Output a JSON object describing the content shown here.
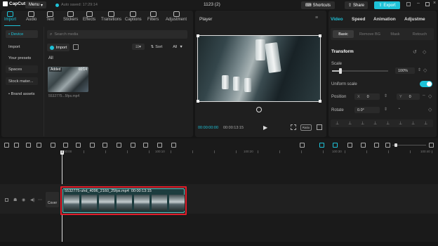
{
  "titlebar": {
    "app_name": "CapCut",
    "menu_label": "Menu",
    "autosave": "Auto saved: 17:29:14",
    "project_name": "1123 (2)",
    "shortcuts_label": "Shortcuts",
    "share_label": "Share",
    "export_label": "Export"
  },
  "toolbar": {
    "items": [
      {
        "label": "Import",
        "icon": "import-icon"
      },
      {
        "label": "Audio",
        "icon": "audio-icon"
      },
      {
        "label": "Text",
        "icon": "text-icon"
      },
      {
        "label": "Stickers",
        "icon": "stickers-icon"
      },
      {
        "label": "Effects",
        "icon": "effects-icon"
      },
      {
        "label": "Transitions",
        "icon": "transitions-icon"
      },
      {
        "label": "Captions",
        "icon": "captions-icon"
      },
      {
        "label": "Filters",
        "icon": "filters-icon"
      },
      {
        "label": "Adjustment",
        "icon": "adjustment-icon"
      }
    ]
  },
  "media_sidebar": {
    "items": [
      "• Device",
      "Import",
      "Your presets",
      "Spaces",
      "Stock mater...",
      "• Brand assets"
    ]
  },
  "media": {
    "search_placeholder": "Search media",
    "import_label": "Import",
    "sort_label": "Sort",
    "all_label": "All",
    "filter_all": "All",
    "clip_badge": "Added",
    "clip_duration": "00:14",
    "clip_name": "5532775...5fps.mp4"
  },
  "player": {
    "title": "Player",
    "current_time": "00:00:00:00",
    "total_time": "00:00:13:15",
    "ratio_label": "Ratio"
  },
  "inspector": {
    "tabs": [
      "Video",
      "Speed",
      "Animation",
      "Adjustme"
    ],
    "subtabs": [
      "Basic",
      "Remove BG",
      "Mask",
      "Retouch"
    ],
    "transform_label": "Transform",
    "scale_label": "Scale",
    "scale_value": "100%",
    "scale_fraction": 0.15,
    "uniform_scale_label": "Uniform scale",
    "position_label": "Position",
    "x_label": "X",
    "x_value": "0",
    "y_label": "Y",
    "y_value": "0",
    "rotate_label": "Rotate",
    "rotate_value": "0.0°"
  },
  "timeline": {
    "ruler_labels": [
      "00:00",
      "100:10",
      "100:20",
      "100:30",
      "100:40"
    ],
    "cover_label": "Cover",
    "clip_label": "5532775-uhd_4096_2160_25fps.mp4",
    "clip_duration": "00:00:13:15",
    "highlight_color": "#e11d2a"
  }
}
